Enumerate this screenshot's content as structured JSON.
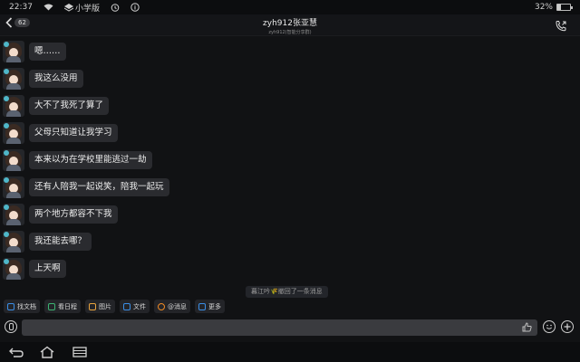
{
  "status_bar": {
    "time": "22:37",
    "app_name": "小学版",
    "battery_text": "32%",
    "battery_level": 0.32,
    "icons": [
      "wifi-icon",
      "layers-icon",
      "alarm-icon",
      "info-icon",
      "battery-icon"
    ]
  },
  "header": {
    "unread_count": "62",
    "title": "zyh912张亚慧",
    "subtitle": "zyh912(智能分享群)"
  },
  "messages": [
    {
      "text": "嗯……"
    },
    {
      "text": "我这么没用"
    },
    {
      "text": "大不了我死了算了"
    },
    {
      "text": "父母只知道让我学习"
    },
    {
      "text": "本来以为在学校里能逃过一劫"
    },
    {
      "text": "还有人陪我一起说笑，陪我一起玩"
    },
    {
      "text": "两个地方都容不下我"
    },
    {
      "text": "我还能去哪？"
    },
    {
      "text": "上天啊"
    }
  ],
  "system_notice": "暮江吟🌾撤回了一条消息",
  "toolbar": [
    {
      "label": "找文档",
      "color": "#3a8ee6"
    },
    {
      "label": "看日程",
      "color": "#3cb371"
    },
    {
      "label": "图片",
      "color": "#e8a33d"
    },
    {
      "label": "文件",
      "color": "#3a8ee6"
    },
    {
      "label": "@消息",
      "color": "#f08a24"
    },
    {
      "label": "更多",
      "color": "#3a8ee6"
    }
  ],
  "input": {
    "placeholder": ""
  }
}
